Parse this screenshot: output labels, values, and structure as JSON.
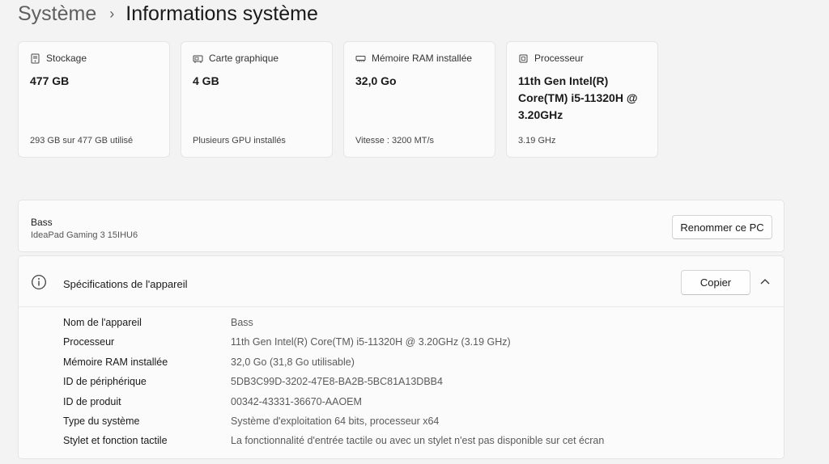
{
  "breadcrumb": {
    "parent": "Système",
    "separator": "›",
    "current": "Informations système"
  },
  "cards": [
    {
      "icon": "storage-icon",
      "label": "Stockage",
      "value": "477 GB",
      "footer": "293 GB sur 477 GB utilisé"
    },
    {
      "icon": "graphics-card-icon",
      "label": "Carte graphique",
      "value": "4 GB",
      "footer": "Plusieurs GPU installés"
    },
    {
      "icon": "ram-icon",
      "label": "Mémoire RAM installée",
      "value": "32,0 Go",
      "footer": "Vitesse : 3200 MT/s"
    },
    {
      "icon": "processor-icon",
      "label": "Processeur",
      "value": "11th Gen Intel(R) Core(TM) i5-11320H @ 3.20GHz",
      "footer": "3.19 GHz"
    }
  ],
  "pc": {
    "name": "Bass",
    "model": "IdeaPad Gaming 3 15IHU6",
    "rename_label": "Renommer ce PC"
  },
  "specs": {
    "title": "Spécifications de l'appareil",
    "copy_label": "Copier",
    "rows": [
      {
        "label": "Nom de l'appareil",
        "value": "Bass"
      },
      {
        "label": "Processeur",
        "value": "11th Gen Intel(R) Core(TM) i5-11320H @ 3.20GHz (3.19 GHz)"
      },
      {
        "label": "Mémoire RAM installée",
        "value": "32,0 Go (31,8 Go utilisable)"
      },
      {
        "label": "ID de périphérique",
        "value": "5DB3C99D-3202-47E8-BA2B-5BC81A13DBB4"
      },
      {
        "label": "ID de produit",
        "value": "00342-43331-36670-AAOEM"
      },
      {
        "label": "Type du système",
        "value": "Système d'exploitation 64 bits, processeur x64"
      },
      {
        "label": "Stylet et fonction tactile",
        "value": "La fonctionnalité d'entrée tactile ou avec un stylet n'est pas disponible sur cet écran"
      }
    ]
  }
}
